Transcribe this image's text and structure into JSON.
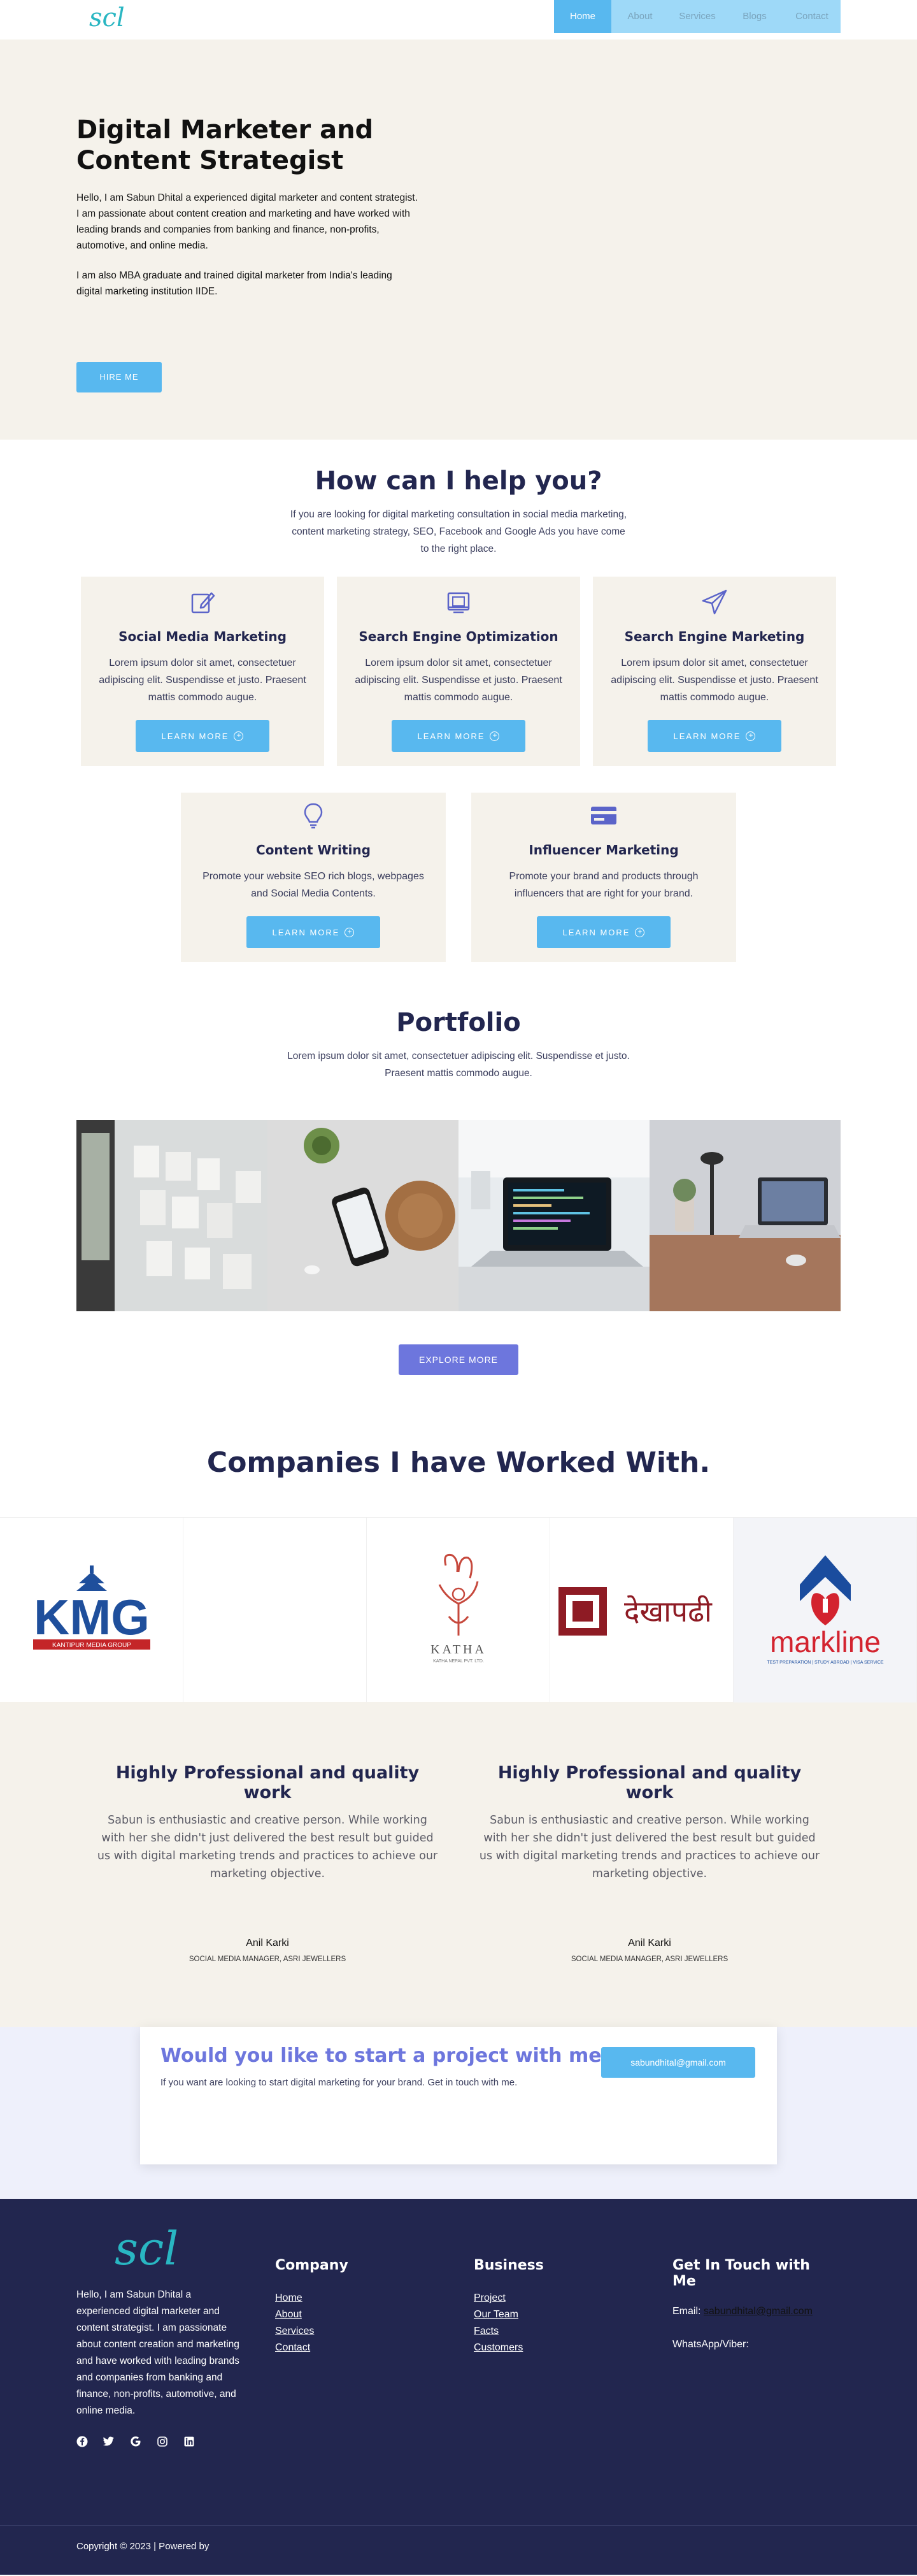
{
  "nav": {
    "logo": "scl",
    "items": [
      {
        "label": "Home",
        "active": true
      },
      {
        "label": "About",
        "active": false
      },
      {
        "label": "Services",
        "active": false
      },
      {
        "label": "Blogs",
        "active": false
      },
      {
        "label": "Contact",
        "active": false
      }
    ]
  },
  "hero": {
    "title": "Digital Marketer and Content Strategist",
    "para1": "Hello, I am Sabun Dhital a experienced digital marketer and content strategist. I am passionate about content creation and marketing and have worked with leading brands and companies from banking and finance, non-profits, automotive, and online media.",
    "para2": "I am also MBA graduate and trained digital marketer from India's leading digital marketing institution IIDE.",
    "button": "HIRE ME"
  },
  "services": {
    "title": "How can I help you?",
    "subtitle": "If you are looking for digital marketing consultation in social media marketing, content marketing strategy, SEO, Facebook and Google Ads you have come to the right place.",
    "learn_more": "LEARN MORE",
    "cards": [
      {
        "icon": "edit-icon",
        "title": "Social Media Marketing",
        "text": "Lorem ipsum dolor sit amet, consectetuer adipiscing elit. Suspendisse et justo. Praesent mattis commodo augue."
      },
      {
        "icon": "seo-icon",
        "title": "Search Engine Optimization",
        "text": "Lorem ipsum dolor sit amet, consectetuer adipiscing elit. Suspendisse et justo. Praesent mattis commodo augue."
      },
      {
        "icon": "paper-plane-icon",
        "title": "Search Engine Marketing",
        "text": "Lorem ipsum dolor sit amet, consectetuer adipiscing elit. Suspendisse et justo. Praesent mattis commodo augue."
      },
      {
        "icon": "lightbulb-icon",
        "title": "Content Writing",
        "text": "Promote your website SEO rich blogs, webpages and Social Media Contents."
      },
      {
        "icon": "credit-card-icon",
        "title": "Influencer Marketing",
        "text": "Promote your brand and products through influencers that are right for your brand."
      }
    ]
  },
  "portfolio": {
    "title": "Portfolio",
    "subtitle": "Lorem ipsum dolor sit amet, consectetuer adipiscing elit. Suspendisse et justo. Praesent mattis commodo augue.",
    "button": "EXPLORE MORE"
  },
  "companies": {
    "title": "Companies I have Worked With.",
    "logos": {
      "kmg": "KMG",
      "kmg_sub": "KANTIPUR MEDIA GROUP",
      "katha": "KATHA",
      "katha_sub": "KATHA NEPAL PVT. LTD.",
      "dekhapadhi": "देखापढी",
      "markline": "markline",
      "markline_sub": "TEST PREPARATION | STUDY ABROAD | VISA SERVICE"
    }
  },
  "testimonials": [
    {
      "title": "Highly Professional and quality work",
      "text": "Sabun is enthusiastic and creative person. While working with her she didn't just delivered the best result but guided us with digital marketing trends and practices to achieve our marketing objective.",
      "name": "Anil Karki",
      "role": "SOCIAL MEDIA MANAGER, ASRI JEWELLERS"
    },
    {
      "title": "Highly Professional and quality work",
      "text": "Sabun is enthusiastic and creative person. While working with her she didn't just delivered the best result but guided us with digital marketing trends and practices to achieve our marketing objective.",
      "name": "Anil Karki",
      "role": "SOCIAL MEDIA MANAGER, ASRI JEWELLERS"
    }
  ],
  "cta": {
    "title": "Would you like to start a project with me?",
    "text": "If you want are looking to start digital marketing for your brand. Get in touch with me.",
    "button": "sabundhital@gmail.com"
  },
  "footer": {
    "logo": "scl",
    "about": "Hello, I am Sabun Dhital a experienced digital marketer and content strategist. I am passionate about content creation and marketing and have worked with leading brands and companies from banking and finance, non-profits, automotive, and online media.",
    "socials": [
      "facebook-icon",
      "twitter-icon",
      "google-icon",
      "instagram-icon",
      "linkedin-icon"
    ],
    "company_title": "Company",
    "company_links": [
      "Home",
      "About",
      "Services",
      "Contact"
    ],
    "business_title": "Business",
    "business_links": [
      "Project",
      "Our Team",
      "Facts",
      "Customers"
    ],
    "contact_title": "Get In Touch with Me",
    "email_label": "Email:",
    "email_value": "sabundhital@gmail.com",
    "whatsapp_label": "WhatsApp/Viber:",
    "copyright": "Copyright © 2023 | Powered by"
  }
}
